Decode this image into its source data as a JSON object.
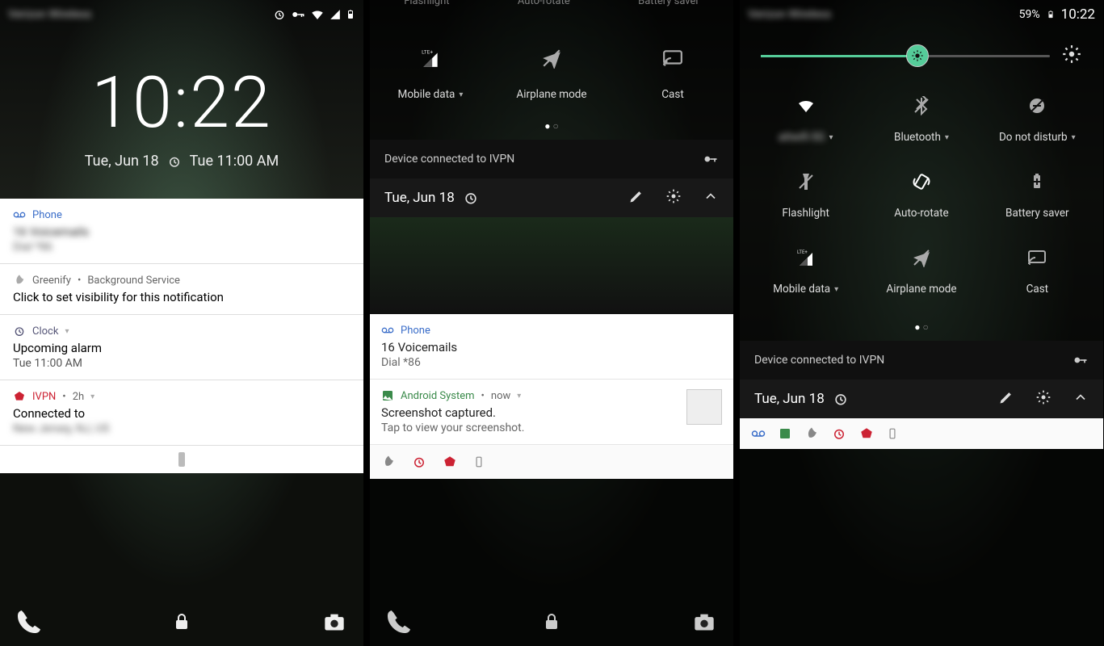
{
  "status": {
    "carrier": "Verizon Wireless",
    "battery_pct": "59%",
    "time": "10:22"
  },
  "p1": {
    "clock": "10:22",
    "date": "Tue, Jun 18",
    "alarm": "Tue 11:00 AM",
    "notifs": {
      "phone": {
        "app": "Phone",
        "title": "16 Voicemails",
        "sub": "Dial *86"
      },
      "greenify": {
        "app": "Greenify",
        "meta": "Background Service",
        "title": "Click to set visibility for this notification"
      },
      "clock": {
        "app": "Clock",
        "title": "Upcoming alarm",
        "sub": "Tue 11:00 AM"
      },
      "ivpn": {
        "app": "IVPN",
        "meta": "2h",
        "title": "Connected to",
        "sub": "New Jersey, NJ, US"
      }
    }
  },
  "p2": {
    "qs_top": {
      "flashlight": "Flashlight",
      "autorotate": "Auto-rotate",
      "battery": "Battery saver"
    },
    "qs": {
      "mobile": "Mobile data",
      "airplane": "Airplane mode",
      "cast": "Cast"
    },
    "vpn": "Device connected to IVPN",
    "date": "Tue, Jun 18",
    "notifs": {
      "phone": {
        "app": "Phone",
        "title": "16 Voicemails",
        "sub": "Dial *86"
      },
      "screenshot": {
        "app": "Android System",
        "meta": "now",
        "title": "Screenshot captured.",
        "sub": "Tap to view your screenshot."
      }
    }
  },
  "p3": {
    "qs": {
      "wifi": "attwifi-5G",
      "bt": "Bluetooth",
      "dnd": "Do not disturb",
      "flash": "Flashlight",
      "rotate": "Auto-rotate",
      "batt": "Battery saver",
      "mobile": "Mobile data",
      "air": "Airplane mode",
      "cast": "Cast"
    },
    "vpn": "Device connected to IVPN",
    "date": "Tue, Jun 18"
  }
}
